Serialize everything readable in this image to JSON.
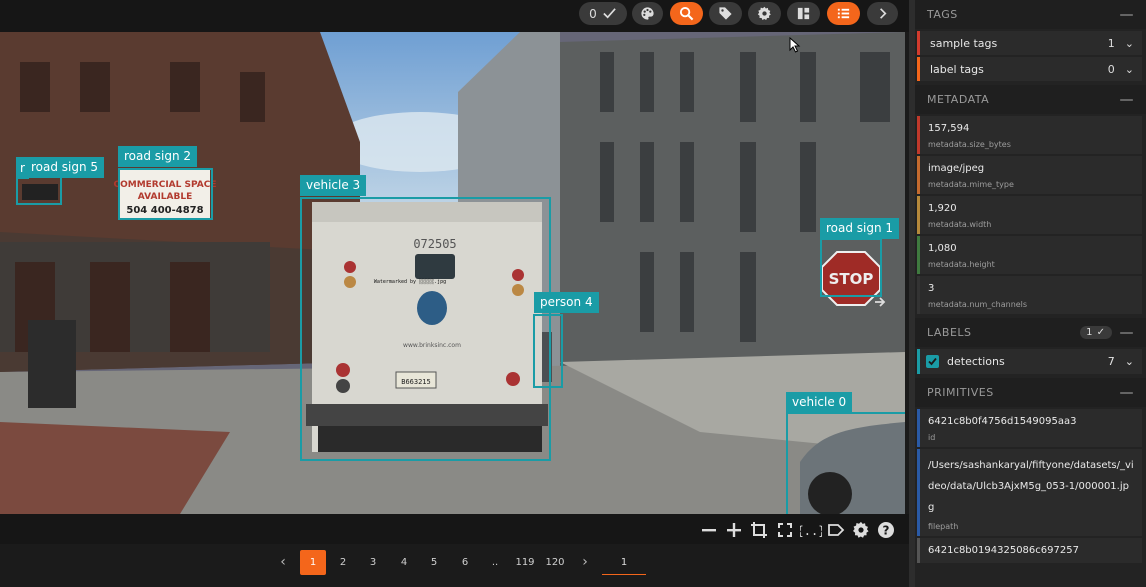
{
  "toolbar": {
    "selected_count": "0",
    "buttons": [
      {
        "name": "selected-count-button",
        "icon": "check-icon"
      },
      {
        "name": "color-palette-button",
        "icon": "palette-icon"
      },
      {
        "name": "search-button",
        "icon": "search-icon",
        "active": true
      },
      {
        "name": "tag-button",
        "icon": "tag-icon"
      },
      {
        "name": "settings-button",
        "icon": "gear-icon"
      },
      {
        "name": "layout-button",
        "icon": "columns-icon"
      },
      {
        "name": "list-button",
        "icon": "list-icon",
        "active": true
      },
      {
        "name": "next-button",
        "icon": "chevron-right-icon"
      }
    ]
  },
  "detections": [
    {
      "label": "road sign 5"
    },
    {
      "label": "road sign 2"
    },
    {
      "label": "vehicle 3"
    },
    {
      "label": "person 4"
    },
    {
      "label": "road sign 1"
    },
    {
      "label": "vehicle 0"
    }
  ],
  "scene_text": {
    "cut_label": "r",
    "sign_line1": "COMMERCIAL SPACE",
    "sign_line2": "AVAILABLE",
    "sign_phone": "504 400-4878",
    "truck_number": "072505",
    "watermark": "Watermarked by ░░░░░.jpg",
    "stop": "STOP",
    "plate": "B663215",
    "truck_web": "www.brinksinc.com"
  },
  "viewer_controls": [
    "zoom-out-icon",
    "zoom-in-icon",
    "crop-icon",
    "fullscreen-icon",
    "json-icon",
    "label-icon",
    "gear-icon",
    "help-icon"
  ],
  "pager": {
    "prev": "‹",
    "pages": [
      "1",
      "2",
      "3",
      "4",
      "5",
      "6",
      "..",
      "119",
      "120"
    ],
    "current": "1",
    "next": "›",
    "input_value": "1"
  },
  "sidebar": {
    "tags": {
      "title": "TAGS",
      "rows": [
        {
          "label": "sample tags",
          "count": "1",
          "color": "#d23b2d"
        },
        {
          "label": "label tags",
          "count": "0",
          "color": "#f4661b"
        }
      ]
    },
    "metadata": {
      "title": "METADATA",
      "rows": [
        {
          "value": "157,594",
          "key": "metadata.size_bytes",
          "color": "#c0392b"
        },
        {
          "value": "image/jpeg",
          "key": "metadata.mime_type",
          "color": "#c46a2e"
        },
        {
          "value": "1,920",
          "key": "metadata.width",
          "color": "#b6893b"
        },
        {
          "value": "1,080",
          "key": "metadata.height",
          "color": "#3f7a3f"
        },
        {
          "value": "3",
          "key": "metadata.num_channels",
          "color": "#333333"
        }
      ]
    },
    "labels": {
      "title": "LABELS",
      "badge": "1",
      "rows": [
        {
          "label": "detections",
          "count": "7",
          "color": "#1a9ca6"
        }
      ]
    },
    "primitives": {
      "title": "PRIMITIVES",
      "rows": [
        {
          "value": "6421c8b0f4756d1549095aa3",
          "key": "id",
          "color": "#2a5aa6"
        },
        {
          "value": "/Users/sashankaryal/fiftyone/datasets/_video/data/Ulcb3AjxM5g_053-1/000001.jpg",
          "key": "filepath",
          "color": "#2a5aa6"
        },
        {
          "value": "6421c8b0194325086c697257",
          "key": "",
          "color": "#555555"
        }
      ]
    }
  },
  "colors": {
    "accent": "#f4661b",
    "detection": "#1a9ca6"
  }
}
